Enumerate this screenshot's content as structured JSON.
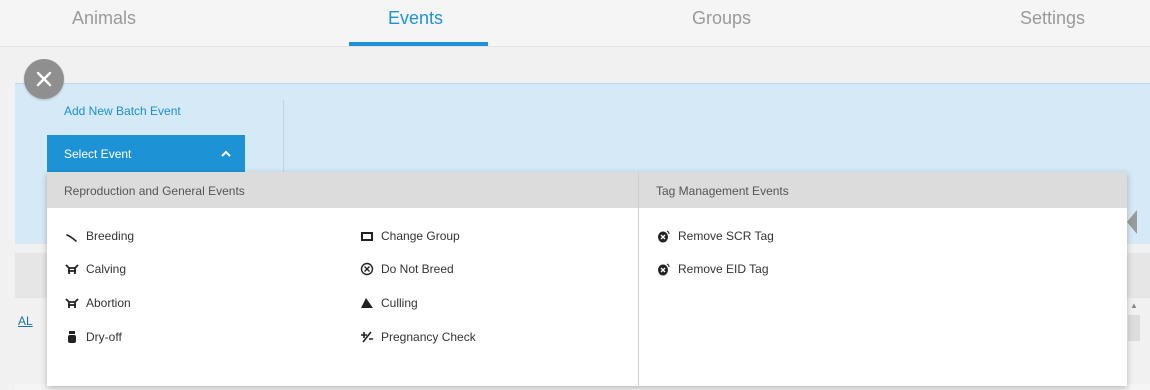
{
  "tabs": [
    {
      "label": "Animals",
      "active": false
    },
    {
      "label": "Events",
      "active": true
    },
    {
      "label": "Groups",
      "active": false
    },
    {
      "label": "Settings",
      "active": false
    }
  ],
  "panel": {
    "title": "Add New Batch Event",
    "select_label": "Select Event"
  },
  "background": {
    "link_text": "AL"
  },
  "dropdown": {
    "left_header": "Reproduction and General Events",
    "right_header": "Tag Management Events",
    "col1": [
      {
        "label": "Breeding",
        "icon": "breeding-icon"
      },
      {
        "label": "Calving",
        "icon": "calving-icon"
      },
      {
        "label": "Abortion",
        "icon": "abortion-icon"
      },
      {
        "label": "Dry-off",
        "icon": "dry-off-icon"
      }
    ],
    "col2": [
      {
        "label": "Change Group",
        "icon": "change-group-icon"
      },
      {
        "label": "Do Not Breed",
        "icon": "do-not-breed-icon"
      },
      {
        "label": "Culling",
        "icon": "culling-icon"
      },
      {
        "label": "Pregnancy Check",
        "icon": "pregnancy-check-icon"
      }
    ],
    "col3": [
      {
        "label": "Remove SCR Tag",
        "icon": "remove-tag-icon"
      },
      {
        "label": "Remove EID Tag",
        "icon": "remove-tag-icon"
      }
    ]
  },
  "colors": {
    "accent": "#1d93d6",
    "panel_bg": "#d5e9f6",
    "header_bg": "#dcdcdc"
  }
}
